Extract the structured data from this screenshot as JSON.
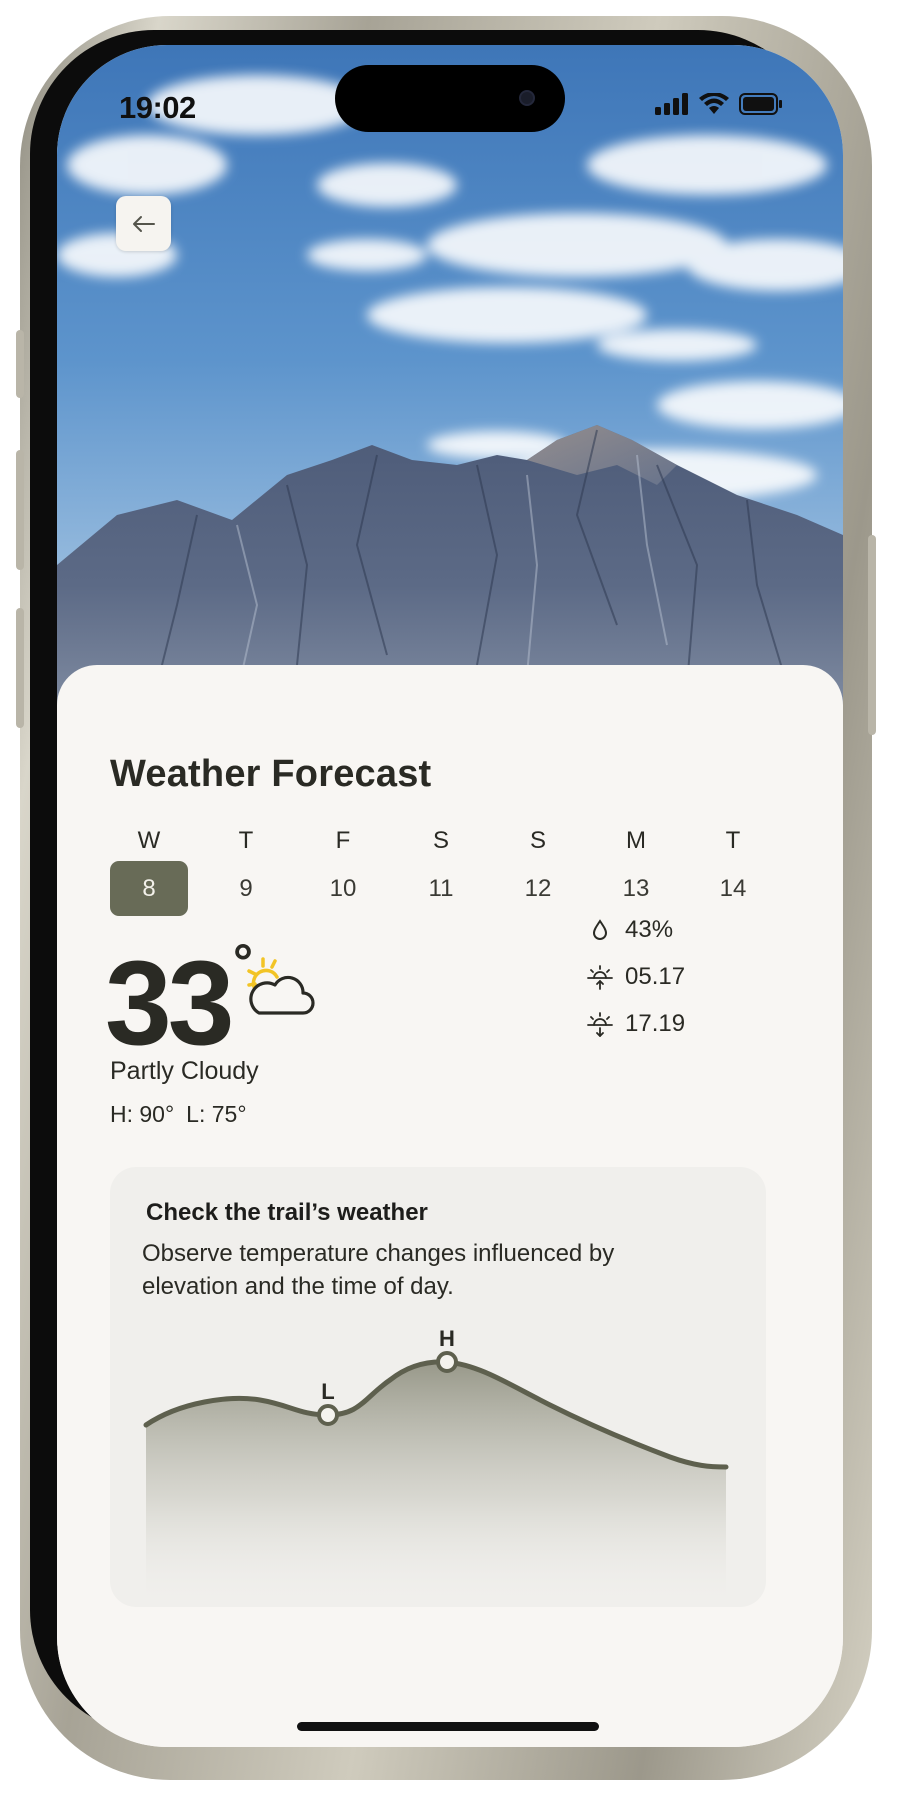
{
  "status_bar": {
    "time": "19:02"
  },
  "header": {
    "back_icon": "arrow-left-icon"
  },
  "page": {
    "title": "Weather Forecast"
  },
  "calendar": {
    "days": [
      {
        "letter": "W",
        "date": "8",
        "selected": true
      },
      {
        "letter": "T",
        "date": "9",
        "selected": false
      },
      {
        "letter": "F",
        "date": "10",
        "selected": false
      },
      {
        "letter": "S",
        "date": "11",
        "selected": false
      },
      {
        "letter": "S",
        "date": "12",
        "selected": false
      },
      {
        "letter": "M",
        "date": "13",
        "selected": false
      },
      {
        "letter": "T",
        "date": "14",
        "selected": false
      }
    ],
    "selected_color": "#686b57"
  },
  "current": {
    "temperature": "33",
    "degree_symbol": "°",
    "icon": "partly-cloudy-icon",
    "condition": "Partly Cloudy",
    "high": "H: 90°",
    "low": "L: 75°"
  },
  "stats": {
    "humidity": {
      "icon": "droplet-icon",
      "value": "43%"
    },
    "sunrise": {
      "icon": "sunrise-icon",
      "value": "05.17"
    },
    "sunset": {
      "icon": "sunset-icon",
      "value": "17.19"
    }
  },
  "trail": {
    "title": "Check the trail’s weather",
    "description": "Observe temperature changes influenced by elevation and the time of day.",
    "low_label": "L",
    "high_label": "H",
    "curve_color": "#5e604e"
  }
}
